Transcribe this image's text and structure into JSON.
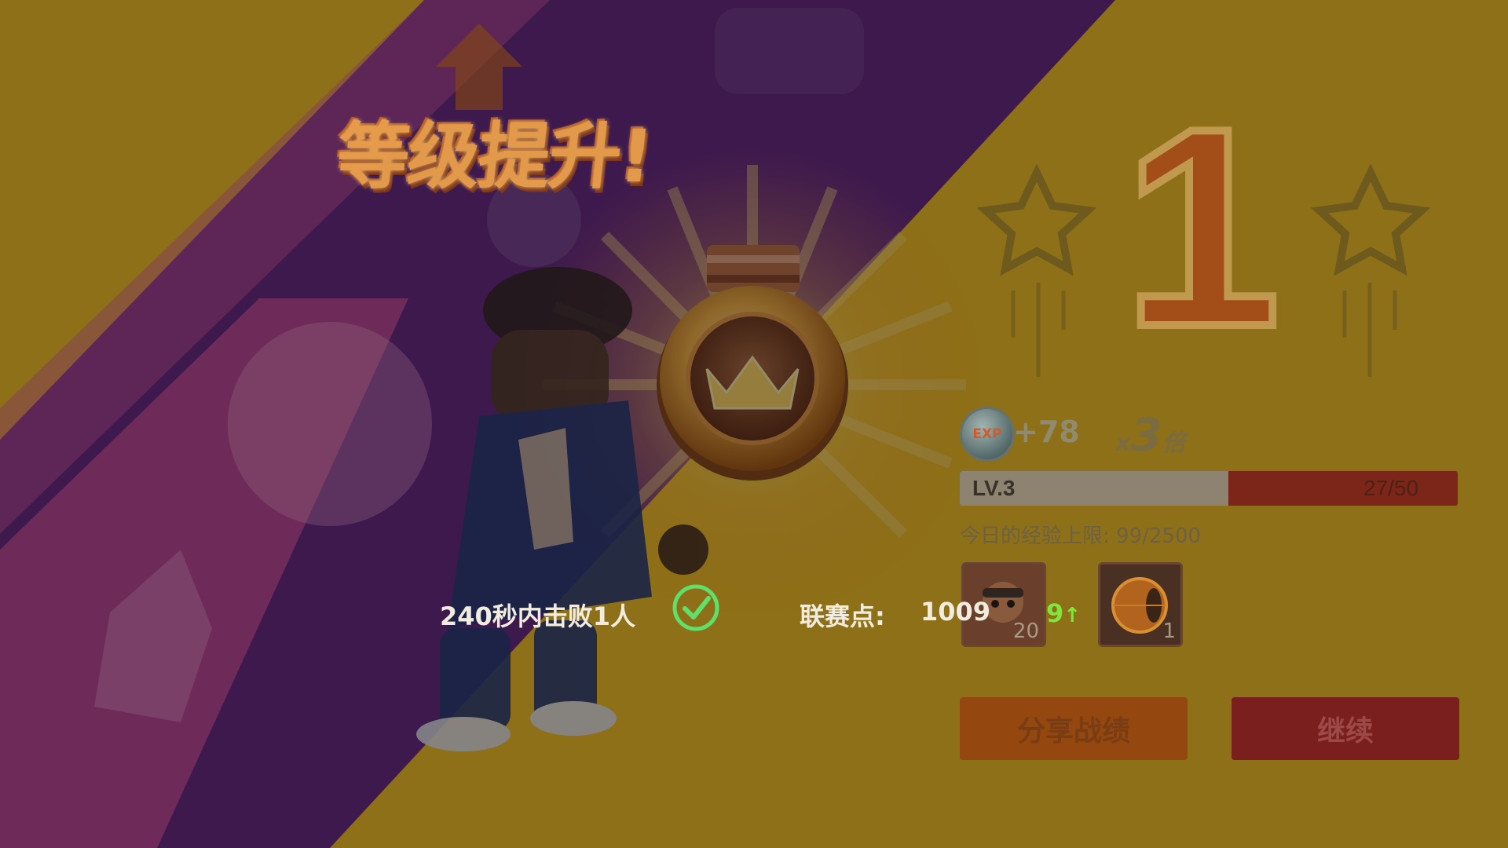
{
  "title": "等级提升!",
  "rank": "1",
  "exp": {
    "badge": "EXP",
    "gain": "+78",
    "multiplier_prefix": "x",
    "multiplier_value": "3",
    "multiplier_suffix": "倍"
  },
  "level": {
    "label": "LV.3",
    "progress_text": "27/50",
    "fraction": 0.54
  },
  "daily_limit": "今日的经验上限: 99/2500",
  "mission": "240秒内击败1人",
  "league": {
    "label": "联赛点:",
    "value": "1009",
    "gain": "9"
  },
  "rewards": [
    {
      "icon": "character-token-icon",
      "count": "20"
    },
    {
      "icon": "orb-item-icon",
      "count": "1"
    }
  ],
  "buttons": {
    "share": "分享战绩",
    "continue": "继续"
  },
  "colors": {
    "accent_green": "#7fe63a",
    "medal_gold": "#f5b24a",
    "bar_red": "#7c2519"
  }
}
